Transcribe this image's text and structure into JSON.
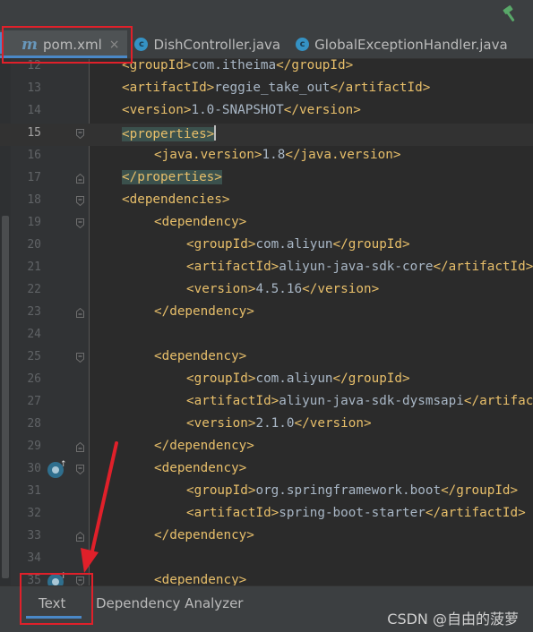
{
  "tabs": [
    {
      "icon": "m",
      "label": "pom.xml",
      "active": true,
      "closable": true
    },
    {
      "icon": "c",
      "label": "DishController.java",
      "active": false,
      "closable": false
    },
    {
      "icon": "c",
      "label": "GlobalExceptionHandler.java",
      "active": false,
      "closable": false
    }
  ],
  "tab_close_glyph": "×",
  "editor": {
    "current_line": "15",
    "lines": [
      {
        "num": "12",
        "indent": 1,
        "parts": [
          [
            "t",
            "<groupId>"
          ],
          [
            "v",
            "com.itheima"
          ],
          [
            "t",
            "</groupId>"
          ]
        ]
      },
      {
        "num": "13",
        "indent": 1,
        "parts": [
          [
            "t",
            "<artifactId>"
          ],
          [
            "v",
            "reggie_take_out"
          ],
          [
            "t",
            "</artifactId>"
          ]
        ]
      },
      {
        "num": "14",
        "indent": 1,
        "parts": [
          [
            "t",
            "<version>"
          ],
          [
            "v",
            "1.0-SNAPSHOT"
          ],
          [
            "t",
            "</version>"
          ]
        ]
      },
      {
        "num": "15",
        "indent": 1,
        "fold": "open",
        "parts": [
          [
            "h",
            "<properties>"
          ]
        ],
        "caret": true
      },
      {
        "num": "16",
        "indent": 2,
        "parts": [
          [
            "t",
            "<java.version>"
          ],
          [
            "v",
            "1.8"
          ],
          [
            "t",
            "</java.version>"
          ]
        ]
      },
      {
        "num": "17",
        "indent": 1,
        "fold": "close",
        "parts": [
          [
            "h",
            "</properties>"
          ]
        ]
      },
      {
        "num": "18",
        "indent": 1,
        "fold": "open",
        "parts": [
          [
            "t",
            "<dependencies>"
          ]
        ]
      },
      {
        "num": "19",
        "indent": 2,
        "fold": "open",
        "parts": [
          [
            "t",
            "<dependency>"
          ]
        ]
      },
      {
        "num": "20",
        "indent": 3,
        "parts": [
          [
            "t",
            "<groupId>"
          ],
          [
            "v",
            "com.aliyun"
          ],
          [
            "t",
            "</groupId>"
          ]
        ]
      },
      {
        "num": "21",
        "indent": 3,
        "parts": [
          [
            "t",
            "<artifactId>"
          ],
          [
            "v",
            "aliyun-java-sdk-core"
          ],
          [
            "t",
            "</artifactId>"
          ]
        ]
      },
      {
        "num": "22",
        "indent": 3,
        "parts": [
          [
            "t",
            "<version>"
          ],
          [
            "v",
            "4.5.16"
          ],
          [
            "t",
            "</version>"
          ]
        ]
      },
      {
        "num": "23",
        "indent": 2,
        "fold": "close",
        "parts": [
          [
            "t",
            "</dependency>"
          ]
        ]
      },
      {
        "num": "24",
        "indent": 0,
        "parts": []
      },
      {
        "num": "25",
        "indent": 2,
        "fold": "open",
        "parts": [
          [
            "t",
            "<dependency>"
          ]
        ]
      },
      {
        "num": "26",
        "indent": 3,
        "parts": [
          [
            "t",
            "<groupId>"
          ],
          [
            "v",
            "com.aliyun"
          ],
          [
            "t",
            "</groupId>"
          ]
        ]
      },
      {
        "num": "27",
        "indent": 3,
        "parts": [
          [
            "t",
            "<artifactId>"
          ],
          [
            "v",
            "aliyun-java-sdk-dysmsapi"
          ],
          [
            "t",
            "</artifactId>"
          ]
        ]
      },
      {
        "num": "28",
        "indent": 3,
        "parts": [
          [
            "t",
            "<version>"
          ],
          [
            "v",
            "2.1.0"
          ],
          [
            "t",
            "</version>"
          ]
        ]
      },
      {
        "num": "29",
        "indent": 2,
        "fold": "close",
        "parts": [
          [
            "t",
            "</dependency>"
          ]
        ]
      },
      {
        "num": "30",
        "indent": 2,
        "fold": "open",
        "gicon": true,
        "parts": [
          [
            "t",
            "<dependency>"
          ]
        ]
      },
      {
        "num": "31",
        "indent": 3,
        "parts": [
          [
            "t",
            "<groupId>"
          ],
          [
            "v",
            "org.springframework.boot"
          ],
          [
            "t",
            "</groupId>"
          ]
        ]
      },
      {
        "num": "32",
        "indent": 3,
        "parts": [
          [
            "t",
            "<artifactId>"
          ],
          [
            "v",
            "spring-boot-starter"
          ],
          [
            "t",
            "</artifactId>"
          ]
        ]
      },
      {
        "num": "33",
        "indent": 2,
        "fold": "close",
        "parts": [
          [
            "t",
            "</dependency>"
          ]
        ]
      },
      {
        "num": "34",
        "indent": 0,
        "parts": []
      },
      {
        "num": "35",
        "indent": 2,
        "fold": "open",
        "gicon": true,
        "parts": [
          [
            "t",
            "<dependency>"
          ]
        ]
      }
    ]
  },
  "bottom_tabs": [
    {
      "label": "Text",
      "active": true
    },
    {
      "label": "Dependency Analyzer",
      "active": false
    }
  ],
  "watermark": "CSDN @自由的菠萝",
  "colors": {
    "annotation_red": "#e0202a",
    "accent_blue": "#4a88c7",
    "xml_tag": "#e8bf6a",
    "xml_text": "#a9b7c6",
    "tag_highlight": "#3b514d"
  }
}
